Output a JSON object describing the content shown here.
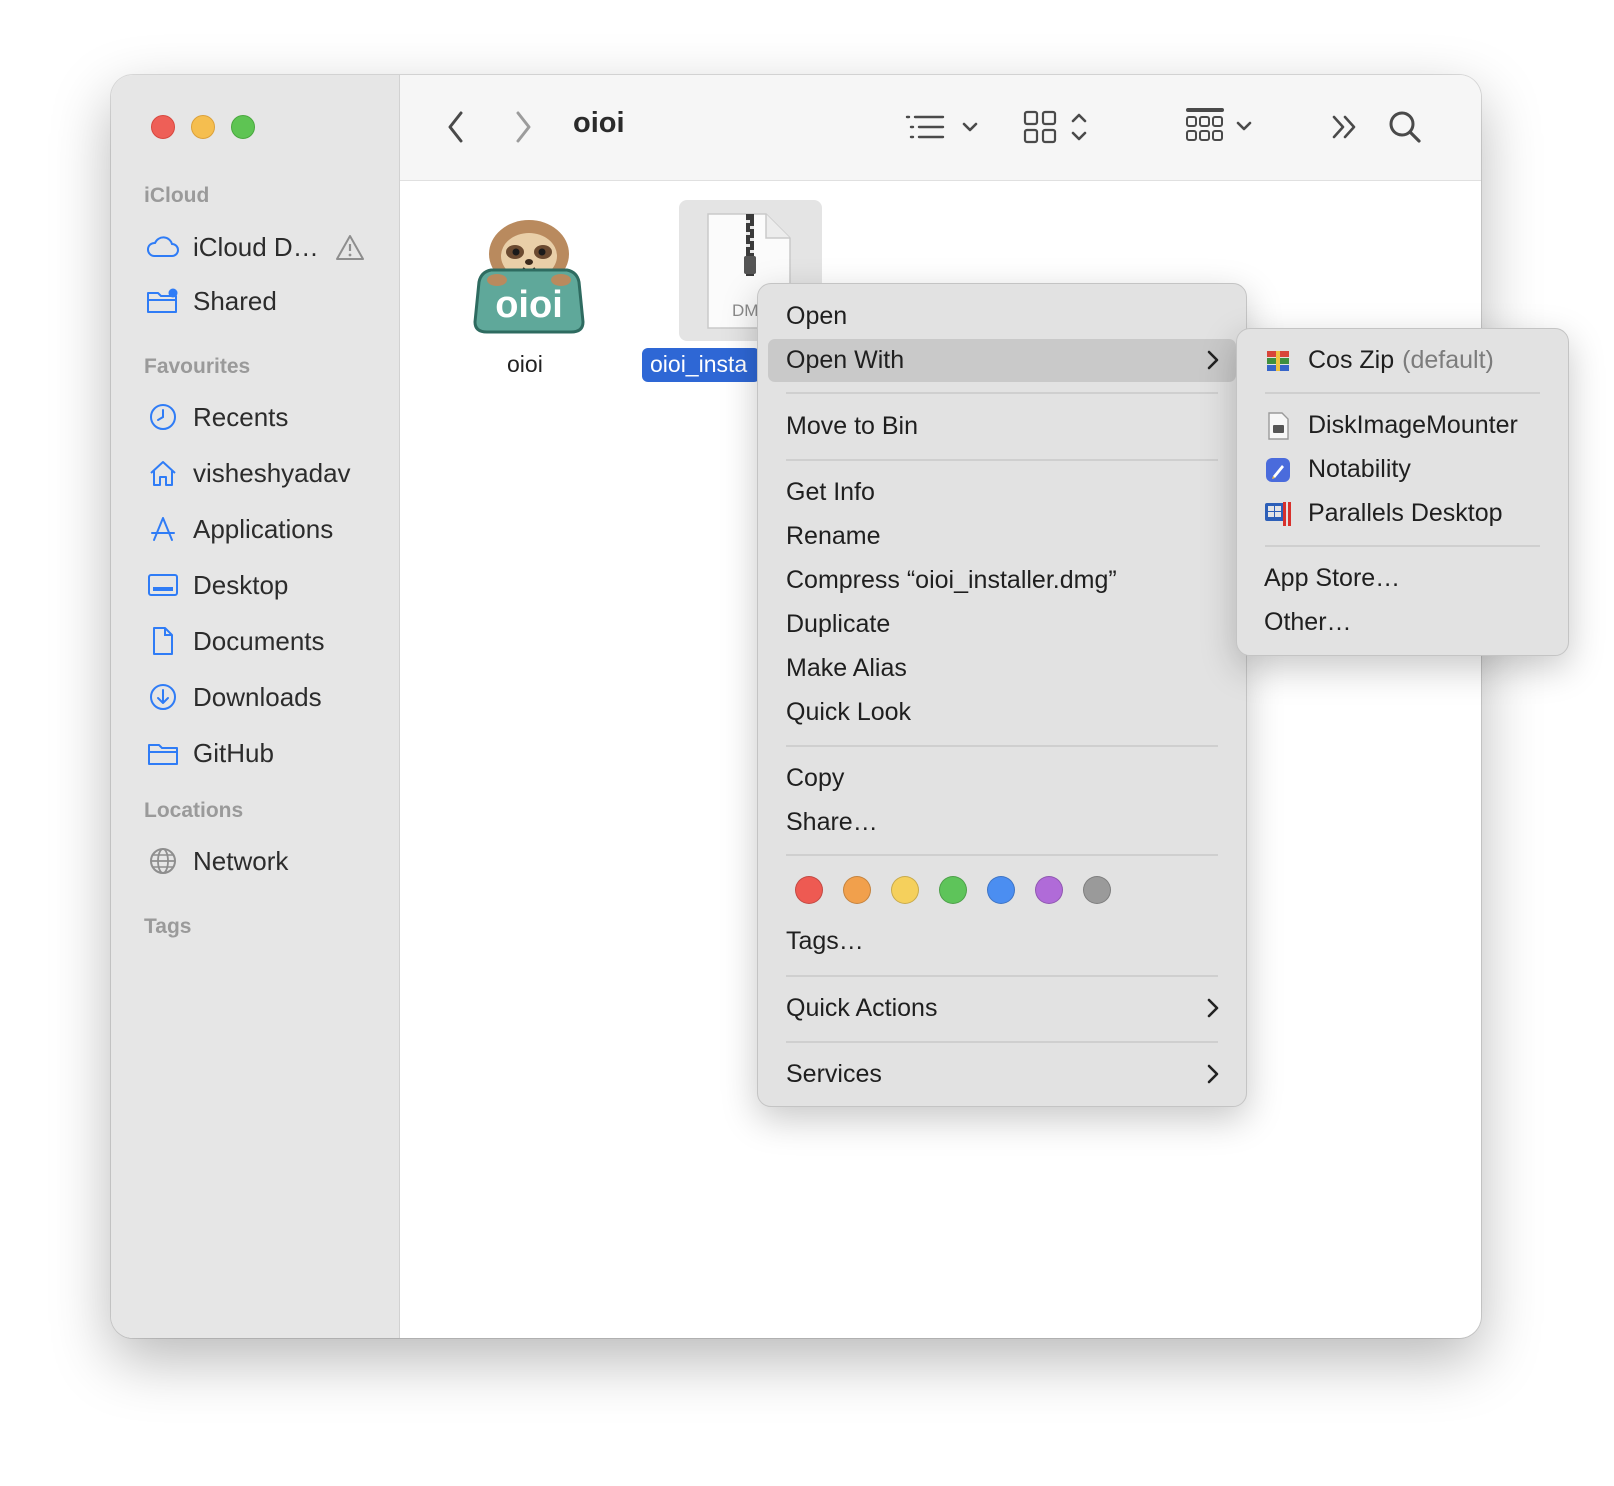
{
  "window": {
    "title": "oioi"
  },
  "sidebar": {
    "sections": {
      "icloud": "iCloud",
      "favourites": "Favourites",
      "locations": "Locations",
      "tags": "Tags"
    },
    "icloud_items": [
      {
        "label": "iCloud D…",
        "icon": "cloud-icon"
      },
      {
        "label": "Shared",
        "icon": "shared-folder-icon"
      }
    ],
    "favourite_items": [
      {
        "label": "Recents",
        "icon": "clock-icon"
      },
      {
        "label": "visheshyadav",
        "icon": "home-icon"
      },
      {
        "label": "Applications",
        "icon": "applications-icon"
      },
      {
        "label": "Desktop",
        "icon": "desktop-icon"
      },
      {
        "label": "Documents",
        "icon": "document-icon"
      },
      {
        "label": "Downloads",
        "icon": "download-icon"
      },
      {
        "label": "GitHub",
        "icon": "folder-icon"
      }
    ],
    "location_items": [
      {
        "label": "Network",
        "icon": "globe-icon"
      }
    ]
  },
  "files": [
    {
      "name": "oioi",
      "icon": "sloth-app-icon",
      "app_text": "oioi"
    },
    {
      "name": "oioi_insta",
      "icon": "dmg-file-icon",
      "type_text": "DM",
      "selected": true
    }
  ],
  "context_menu": {
    "items": {
      "open": "Open",
      "open_with": "Open With",
      "move_to_bin": "Move to Bin",
      "get_info": "Get Info",
      "rename": "Rename",
      "compress": "Compress “oioi_installer.dmg”",
      "duplicate": "Duplicate",
      "make_alias": "Make Alias",
      "quick_look": "Quick Look",
      "copy": "Copy",
      "share": "Share…",
      "tags": "Tags…",
      "quick_actions": "Quick Actions",
      "services": "Services"
    },
    "tag_colors": [
      {
        "name": "red",
        "color": "#ee5a52"
      },
      {
        "name": "orange",
        "color": "#f1a04c"
      },
      {
        "name": "yellow",
        "color": "#f5d05c"
      },
      {
        "name": "green",
        "color": "#5ec45a"
      },
      {
        "name": "blue",
        "color": "#4b8ef1"
      },
      {
        "name": "purple",
        "color": "#b06bd8"
      },
      {
        "name": "grey",
        "color": "#9a9a9a"
      }
    ]
  },
  "open_with_submenu": {
    "default_app": "Cos Zip",
    "default_suffix": "(default)",
    "apps": [
      "DiskImageMounter",
      "Notability",
      "Parallels Desktop"
    ],
    "app_store": "App Store…",
    "other": "Other…"
  },
  "colors": {
    "selection": "#2e67d5",
    "accent": "#2f7cf6"
  }
}
